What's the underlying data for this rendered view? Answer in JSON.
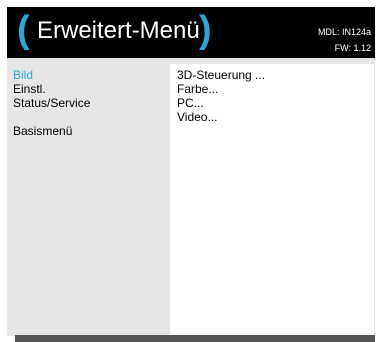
{
  "header": {
    "title": "Erweitert-Menü",
    "paren_left": "(",
    "paren_right": ")",
    "model": "MDL: IN124a",
    "firmware": "FW: 1.12"
  },
  "sidebar": {
    "items": [
      {
        "label": "Bild",
        "active": true
      },
      {
        "label": "Einstl.",
        "active": false
      },
      {
        "label": "Status/Service",
        "active": false
      },
      {
        "label": "Basismenü",
        "active": false
      }
    ]
  },
  "submenu": {
    "items": [
      {
        "label": "3D-Steuerung ..."
      },
      {
        "label": "Farbe..."
      },
      {
        "label": "PC..."
      },
      {
        "label": "Video..."
      }
    ]
  },
  "colors": {
    "accent": "#2ba6d9",
    "header_bg": "#000000",
    "menu_bg": "#e6e6e6",
    "panel_bg": "#ffffff"
  }
}
